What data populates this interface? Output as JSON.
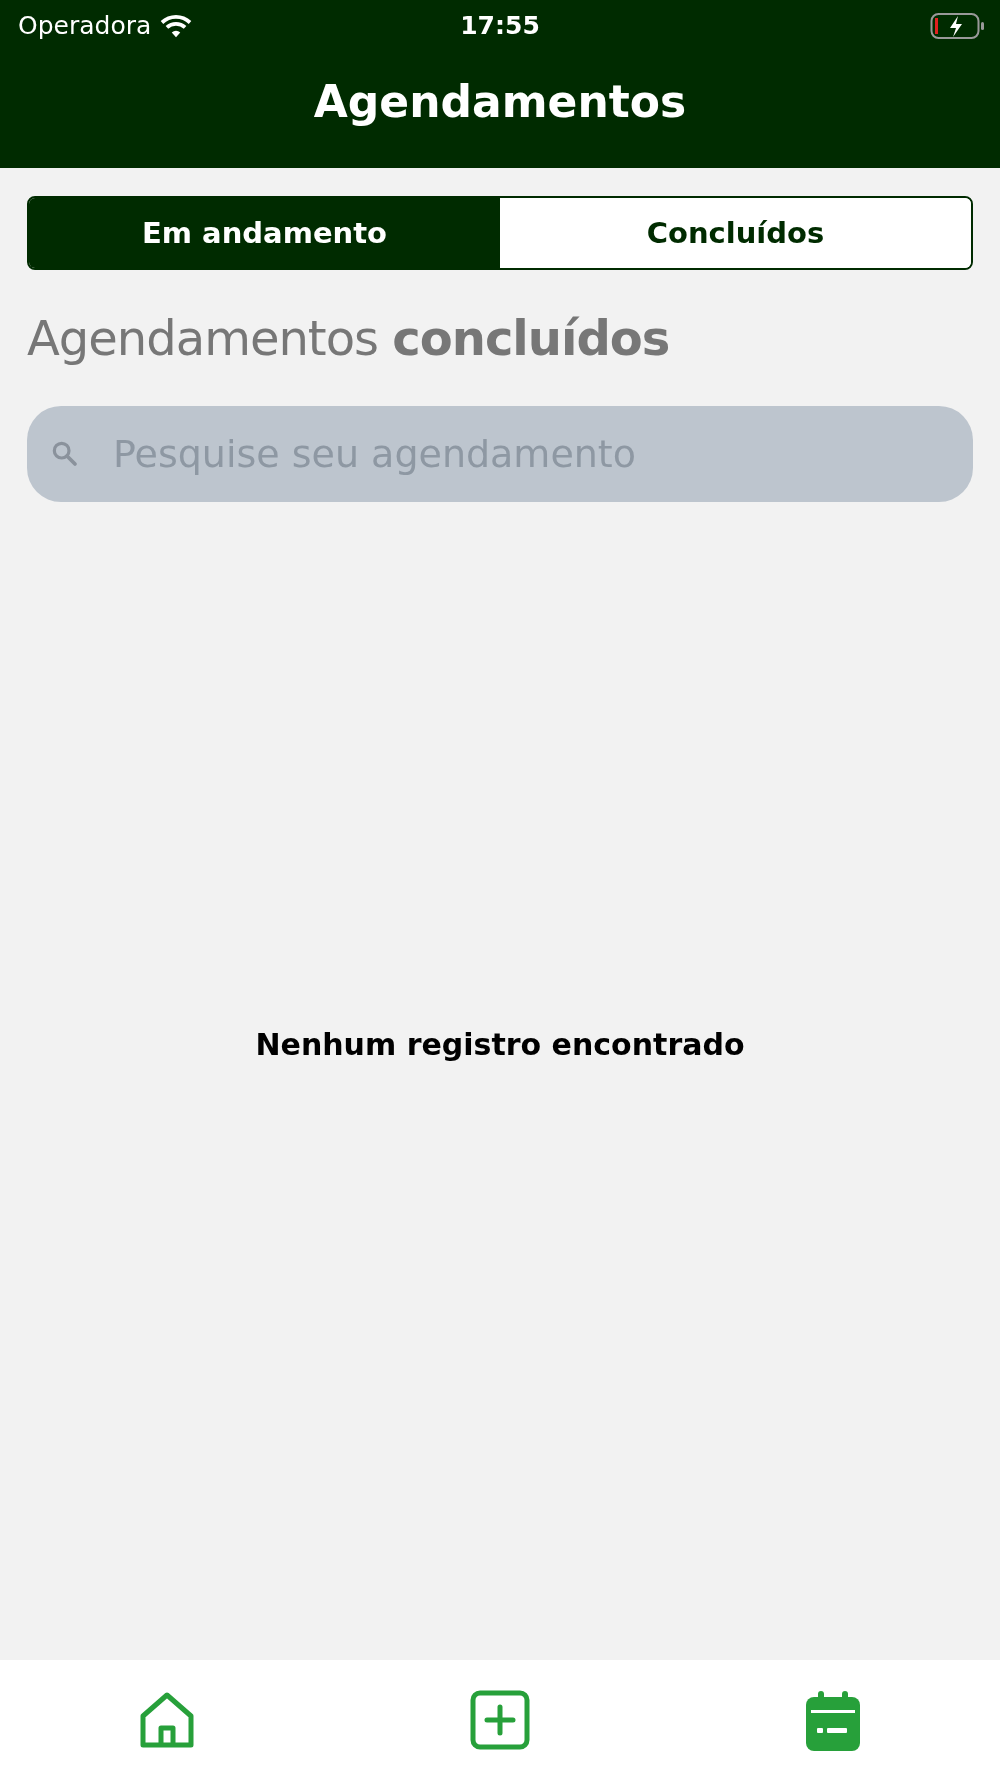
{
  "status_bar": {
    "carrier": "Operadora",
    "time": "17:55"
  },
  "header": {
    "title": "Agendamentos"
  },
  "tabs": [
    {
      "label": "Em andamento",
      "selected": true
    },
    {
      "label": "Concluídos",
      "selected": false
    }
  ],
  "heading": "Agendamentos **concluídos**",
  "search": {
    "placeholder": "Pesquise seu agendamento"
  },
  "empty_message": "Nenhum registro encontrado",
  "bottom_nav": [
    {
      "kind": "home"
    },
    {
      "kind": "add"
    },
    {
      "kind": "calendar"
    }
  ]
}
